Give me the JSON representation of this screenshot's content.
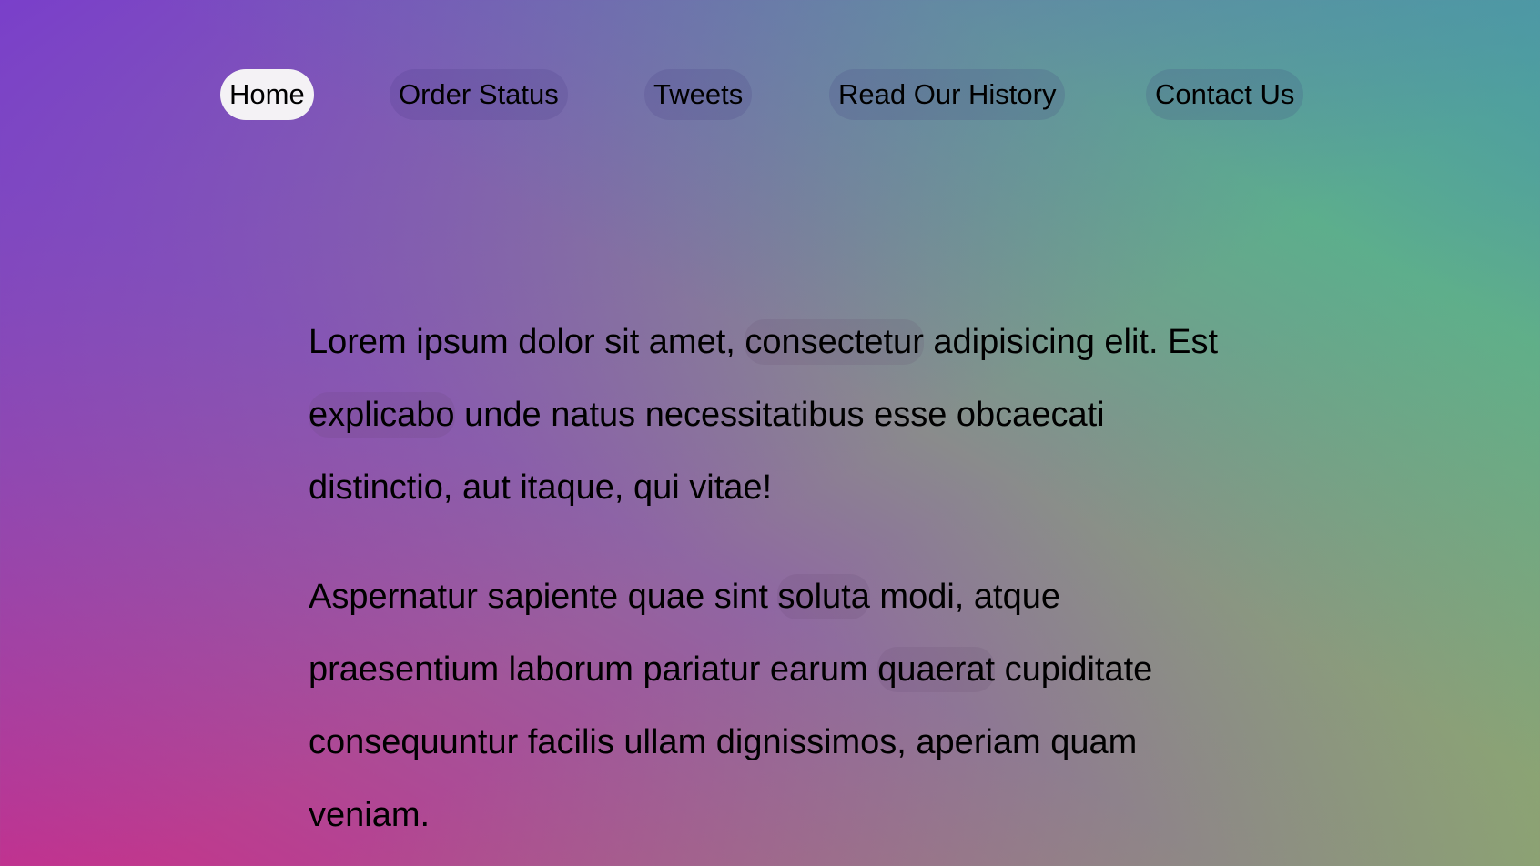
{
  "nav": {
    "items": [
      {
        "label": "Home",
        "active": true
      },
      {
        "label": "Order Status",
        "active": false
      },
      {
        "label": "Tweets",
        "active": false
      },
      {
        "label": "Read Our History",
        "active": false
      },
      {
        "label": "Contact Us",
        "active": false
      }
    ]
  },
  "content": {
    "p1": {
      "s1": "Lorem ipsum dolor sit amet, ",
      "w1": "consectetur",
      "s2": " adipisicing elit. Est ",
      "w2": "explicabo",
      "s3": " unde natus necessitatibus esse obcaecati distinctio, aut itaque, qui vitae!"
    },
    "p2": {
      "s1": "Aspernatur sapiente quae sint ",
      "w1": "soluta",
      "s2": " modi, atque praesentium laborum pariatur earum ",
      "w2": "quaerat",
      "s3": " cupiditate consequuntur facilis ullam dignissimos, aperiam quam veniam."
    }
  },
  "colors": {
    "active_pill_bg": "#f4f2f5",
    "gradient_top_left": "#7a3fca",
    "gradient_bottom_left": "#c7318a",
    "gradient_top_right": "#4d96a8",
    "gradient_bottom_right": "#8cbd5a"
  }
}
